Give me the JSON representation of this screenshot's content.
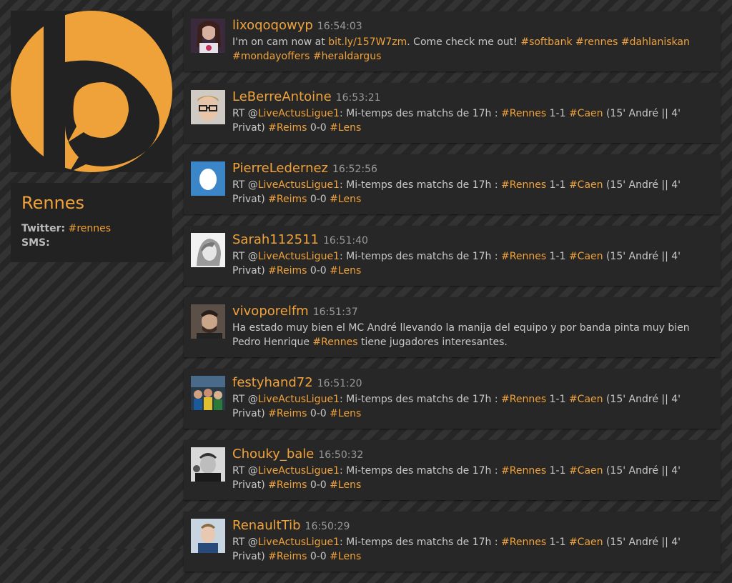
{
  "colors": {
    "accent": "#f0a23a",
    "panel": "#222222",
    "card": "#272727"
  },
  "sidebar": {
    "location": "Rennes",
    "twitter_label": "Twitter:",
    "twitter_tag": "#rennes",
    "sms_label": "SMS:"
  },
  "tweets": [
    {
      "user": "lixoqoqowyp",
      "time": "16:54:03",
      "t1": "I'm on cam now at ",
      "link": "bit.ly/157W7zm",
      "t2": ". Come check me out! ",
      "h1": "#softbank",
      "h2": "#rennes",
      "h3": "#dahlaniskan",
      "h4": "#mondayoffers",
      "h5": "#heraldargus"
    },
    {
      "user": "LeBerreAntoine",
      "time": "16:53:21",
      "rt": "RT @",
      "mention": "LiveActusLigue1",
      "t1": ": Mi-temps des matchs de 17h : ",
      "h1": "#Rennes",
      "t2": " 1-1 ",
      "h2": "#Caen",
      "t3": " (15' André || 4' Privat)",
      "h3": "#Reims",
      "t4": " 0-0 ",
      "h4": "#Lens"
    },
    {
      "user": "PierreLedernez",
      "time": "16:52:56",
      "rt": "RT @",
      "mention": "LiveActusLigue1",
      "t1": ": Mi-temps des matchs de 17h : ",
      "h1": "#Rennes",
      "t2": " 1-1 ",
      "h2": "#Caen",
      "t3": " (15' André || 4' Privat)",
      "h3": "#Reims",
      "t4": " 0-0 ",
      "h4": "#Lens"
    },
    {
      "user": "Sarah112511",
      "time": "16:51:40",
      "rt": "RT @",
      "mention": "LiveActusLigue1",
      "t1": ": Mi-temps des matchs de 17h : ",
      "h1": "#Rennes",
      "t2": " 1-1 ",
      "h2": "#Caen",
      "t3": " (15' André || 4' Privat)",
      "h3": "#Reims",
      "t4": " 0-0 ",
      "h4": "#Lens"
    },
    {
      "user": "vivoporelfm",
      "time": "16:51:37",
      "t1": "Ha estado muy bien el MC André llevando la manija del equipo y por banda pinta muy bien Pedro Henrique ",
      "h1": "#Rennes",
      "t2": " tiene jugadores interesantes."
    },
    {
      "user": "festyhand72",
      "time": "16:51:20",
      "rt": "RT @",
      "mention": "LiveActusLigue1",
      "t1": ": Mi-temps des matchs de 17h : ",
      "h1": "#Rennes",
      "t2": " 1-1 ",
      "h2": "#Caen",
      "t3": " (15' André || 4' Privat)",
      "h3": "#Reims",
      "t4": " 0-0 ",
      "h4": "#Lens"
    },
    {
      "user": "Chouky_bale",
      "time": "16:50:32",
      "rt": "RT @",
      "mention": "LiveActusLigue1",
      "t1": ": Mi-temps des matchs de 17h : ",
      "h1": "#Rennes",
      "t2": " 1-1 ",
      "h2": "#Caen",
      "t3": " (15' André || 4' Privat)",
      "h3": "#Reims",
      "t4": " 0-0 ",
      "h4": "#Lens"
    },
    {
      "user": "RenaultTib",
      "time": "16:50:29",
      "rt": "RT @",
      "mention": "LiveActusLigue1",
      "t1": ": Mi-temps des matchs de 17h : ",
      "h1": "#Rennes",
      "t2": " 1-1 ",
      "h2": "#Caen",
      "t3": " (15' André || 4' Privat)",
      "h3": "#Reims",
      "t4": " 0-0 ",
      "h4": "#Lens"
    }
  ]
}
